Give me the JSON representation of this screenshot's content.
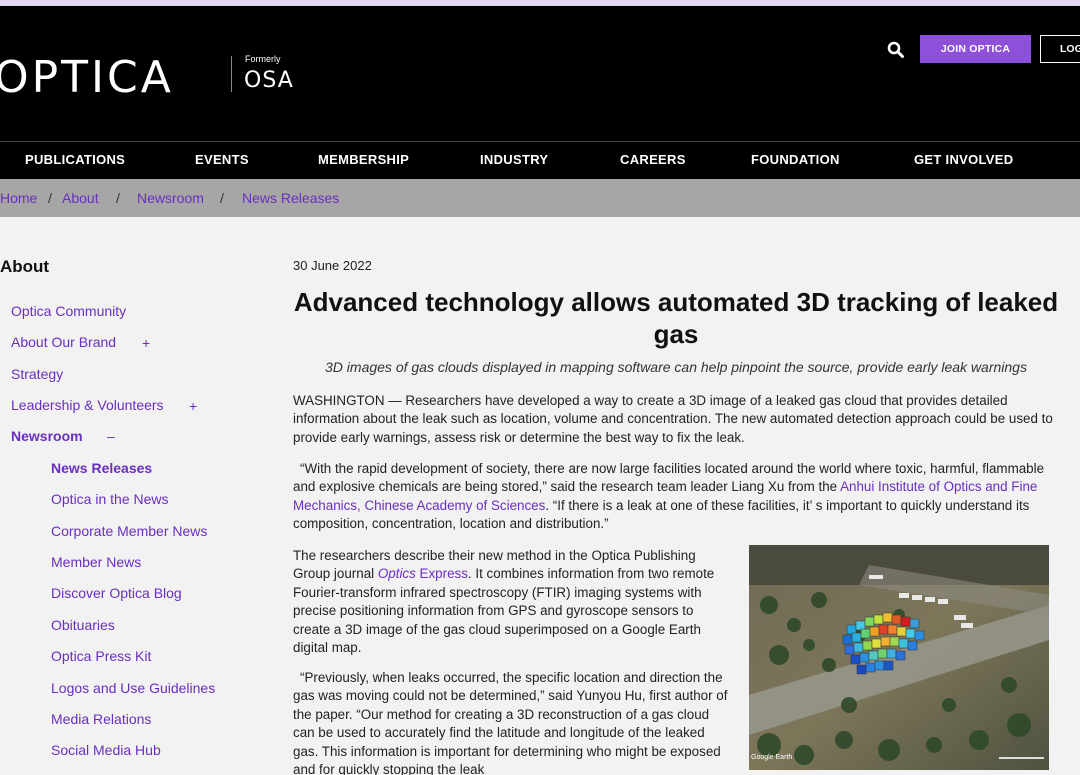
{
  "header": {
    "logo": "OPTICA",
    "formerly_label": "Formerly",
    "former_name": "OSA",
    "join_label": "JOIN OPTICA",
    "login_label": "LOG"
  },
  "nav": {
    "items": [
      "PUBLICATIONS",
      "EVENTS",
      "MEMBERSHIP",
      "INDUSTRY",
      "CAREERS",
      "FOUNDATION",
      "GET INVOLVED"
    ]
  },
  "breadcrumb": {
    "items": [
      "Home",
      "About",
      "Newsroom",
      "News Releases"
    ],
    "separator": "/"
  },
  "sidebar": {
    "title": "About",
    "items": [
      {
        "label": "Optica Community"
      },
      {
        "label": "About Our Brand",
        "toggle": "+"
      },
      {
        "label": "Strategy"
      },
      {
        "label": "Leadership & Volunteers",
        "toggle": "+"
      },
      {
        "label": "Newsroom",
        "toggle": "–"
      },
      {
        "label": "News Releases"
      },
      {
        "label": "Optica in the News"
      },
      {
        "label": "Corporate Member News"
      },
      {
        "label": "Member News"
      },
      {
        "label": "Discover Optica Blog"
      },
      {
        "label": "Obituaries"
      },
      {
        "label": "Optica Press Kit"
      },
      {
        "label": "Logos and Use Guidelines"
      },
      {
        "label": "Media Relations"
      },
      {
        "label": "Social Media Hub"
      }
    ]
  },
  "article": {
    "date": "30 June 2022",
    "title": "Advanced technology allows automated 3D tracking of leaked gas",
    "subtitle": "3D images of gas clouds displayed in mapping software can help pinpoint the source, provide early leak warnings",
    "p1": "WASHINGTON — Researchers have developed a way to create a 3D image of a leaked gas cloud that provides detailed information about the leak such as location, volume and concentration. The new automated detection approach could be used to provide early warnings, assess risk or determine the best way to fix the leak.",
    "p2_a": "“With the rapid development of society, there are now large facilities located around the world where toxic, harmful, flammable and explosive chemicals are being stored,”  said the research team leader Liang Xu from the ",
    "p2_link": "Anhui Institute of Optics and Fine Mechanics, Chinese Academy of Sciences",
    "p2_b": ".  “If there is a leak at one of these facilities, it’ s important to quickly understand its composition, concentration, location and distribution.”",
    "p3_a": "The researchers describe their new method in the Optica Publishing Group journal ",
    "p3_link_italic": "Optics",
    "p3_link_rest": " Express",
    "p3_b": ". It combines information from two remote Fourier-transform infrared spectroscopy (FTIR) imaging systems with precise positioning information from GPS and gyroscope sensors to create a 3D image of the gas cloud superimposed on a Google Earth digital map.",
    "p4": "“Previously, when leaks occurred, the specific location and direction the gas was moving could not be determined,”  said Yunyou Hu, first author of the paper.  “Our method for creating a 3D reconstruction of a gas cloud can be used to accurately find the latitude and longitude of the leaked gas. This information is important for determining who might be exposed and for quickly stopping the leak",
    "photo_watermark": "Google Earth"
  },
  "colors": {
    "accent": "#8e4fdb",
    "link": "#6a2fc0",
    "header_bg": "#000000",
    "breadcrumb_bg": "#a6a6a6"
  }
}
